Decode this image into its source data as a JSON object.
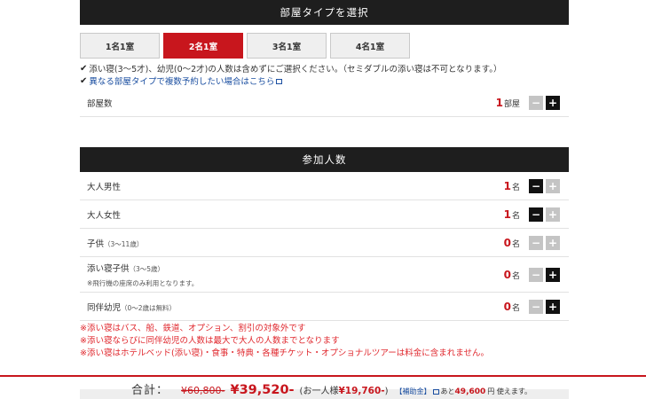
{
  "room_section": {
    "title": "部屋タイプを選択",
    "tabs": [
      {
        "label": "1名1室",
        "active": false
      },
      {
        "label": "2名1室",
        "active": true
      },
      {
        "label": "3名1室",
        "active": false
      },
      {
        "label": "4名1室",
        "active": false
      }
    ],
    "notes": {
      "infant_note": "添い寝(3〜5才)、幼児(0〜2才)の人数は含めずにご選択ください。（セミダブルの添い寝は不可となります。）",
      "multi_link": "異なる部屋タイプで複数予約したい場合はこちら"
    },
    "rooms": {
      "label": "部屋数",
      "value": "1",
      "unit": "部屋",
      "minus": "−",
      "plus": "+"
    }
  },
  "participants_section": {
    "title": "参加人数",
    "rows": [
      {
        "label": "大人男性",
        "sub": "",
        "note": "",
        "value": "1",
        "unit": "名",
        "minus": "−",
        "plus": "+"
      },
      {
        "label": "大人女性",
        "sub": "",
        "note": "",
        "value": "1",
        "unit": "名",
        "minus": "−",
        "plus": "+"
      },
      {
        "label": "子供",
        "sub": "（3〜11歳）",
        "note": "",
        "value": "0",
        "unit": "名",
        "minus": "−",
        "plus": "+"
      },
      {
        "label": "添い寝子供",
        "sub": "（3〜5歳）",
        "note": "※飛行機の座席のみ利用となります。",
        "value": "0",
        "unit": "名",
        "minus": "−",
        "plus": "+"
      },
      {
        "label": "同伴幼児",
        "sub": "（0〜2歳は無料）",
        "note": "",
        "value": "0",
        "unit": "名",
        "minus": "−",
        "plus": "+"
      }
    ],
    "red_notes": [
      "※添い寝はバス、船、鉄道、オプション、割引の対象外です",
      "※添い寝ならびに同伴幼児の人数は最大で大人の人数までとなります",
      "※添い寝はホテルベッド(添い寝)・食事・特典・各種チケット・オプショナルツアーは料金に含まれません。"
    ]
  },
  "footer": {
    "total_label": "合計：",
    "original_price": "¥60,800-",
    "price": "¥39,520-",
    "per_person_prefix": "(お一人様",
    "per_person_value": "¥19,760-",
    "per_person_suffix": ")",
    "subsidy_label": "【補助金】",
    "remaining_prefix": "あと",
    "remaining_value": "49,600",
    "remaining_suffix": "円 使えます。"
  },
  "colors": {
    "accent_red": "#c8161d",
    "header_black": "#1e1e1e",
    "link_blue": "#1a4ea0",
    "note_red": "#e0282e"
  }
}
